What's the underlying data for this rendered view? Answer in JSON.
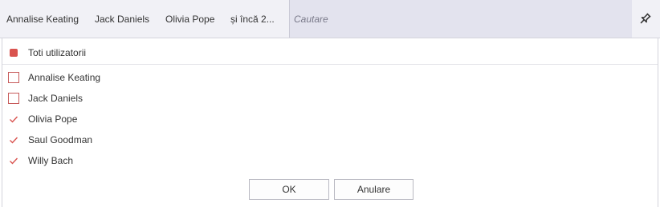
{
  "selected_chips": [
    "Annalise Keating",
    "Jack Daniels",
    "Olivia Pope",
    "și încă 2..."
  ],
  "search": {
    "placeholder": "Cautare"
  },
  "select_all": {
    "label": "Toti utilizatorii",
    "state": "partial"
  },
  "users": [
    {
      "label": "Annalise Keating",
      "checked": false
    },
    {
      "label": "Jack Daniels",
      "checked": false
    },
    {
      "label": "Olivia Pope",
      "checked": true
    },
    {
      "label": "Saul Goodman",
      "checked": true
    },
    {
      "label": "Willy Bach",
      "checked": true
    }
  ],
  "buttons": {
    "ok": "OK",
    "cancel": "Anulare"
  },
  "colors": {
    "accent": "#d9534f",
    "topbar": "#f1f1f6",
    "search_bg": "#e3e3ee"
  },
  "icons": {
    "pin": "pin-icon"
  }
}
